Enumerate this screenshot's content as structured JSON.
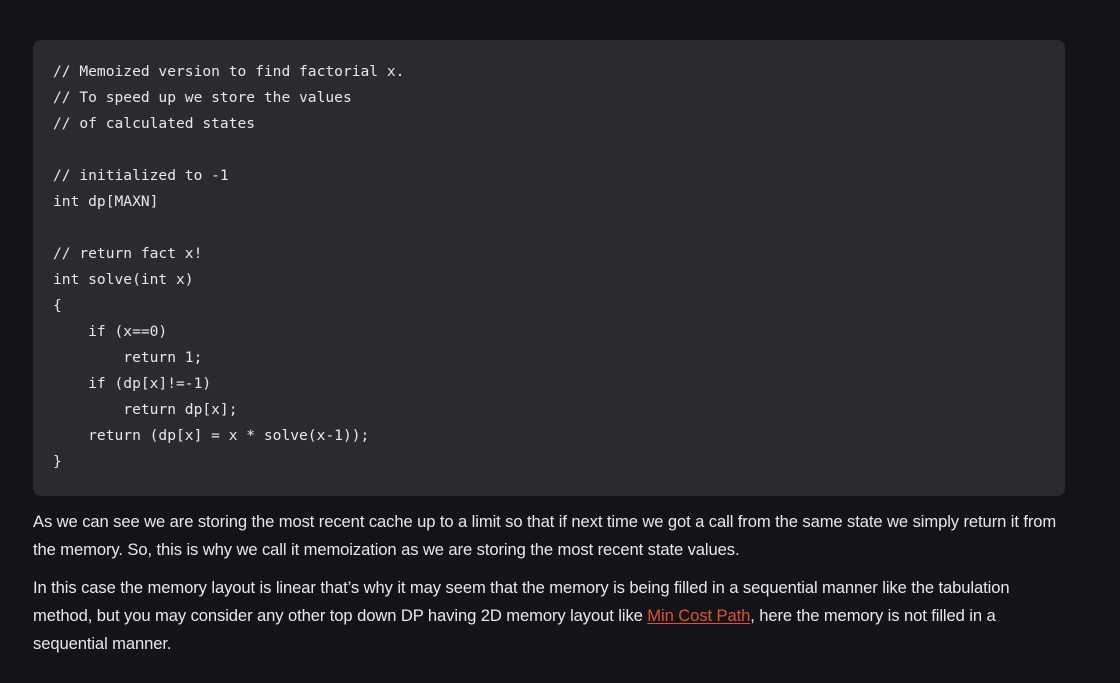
{
  "code": {
    "lines": [
      "// Memoized version to find factorial x.",
      "// To speed up we store the values",
      "// of calculated states",
      "",
      "// initialized to -1",
      "int dp[MAXN]",
      "",
      "// return fact x!",
      "int solve(int x)",
      "{",
      "    if (x==0)",
      "        return 1;",
      "    if (dp[x]!=-1)",
      "        return dp[x];",
      "    return (dp[x] = x * solve(x-1));",
      "}"
    ]
  },
  "paragraphs": {
    "p1": "As we can see we are storing the most recent cache up to a limit so that if next time we got a call from the same state we simply return it from the memory. So, this is why we call it memoization as we are storing the most recent state values.",
    "p2_before": "In this case the memory layout is linear that’s why it may seem that the memory is being filled in a sequential manner like the tabulation method, but you may consider any other top down DP having 2D memory layout like ",
    "p2_link": "Min Cost Path",
    "p2_after": ", here the memory is not filled in a sequential manner."
  },
  "colors": {
    "background": "#131417",
    "code_background": "#2a2b2e",
    "text": "#e8e8e8",
    "link": "#e0522a"
  }
}
